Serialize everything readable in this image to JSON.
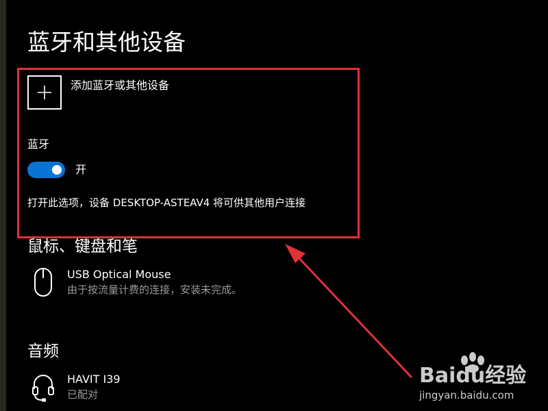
{
  "page": {
    "title": "蓝牙和其他设备"
  },
  "add_device": {
    "label": "添加蓝牙或其他设备",
    "icon": "plus-icon"
  },
  "bluetooth": {
    "label": "蓝牙",
    "toggle_on": true,
    "state_label": "开",
    "description": "打开此选项，设备 DESKTOP-ASTEAV4 将可供其他用户连接"
  },
  "sections": {
    "mouse_keyboard_pen": {
      "title": "鼠标、键盘和笔",
      "devices": [
        {
          "icon": "mouse-icon",
          "name": "USB Optical Mouse",
          "status": "由于按流量计费的连接，安装未完成。"
        }
      ]
    },
    "audio": {
      "title": "音频",
      "devices": [
        {
          "icon": "headset-icon",
          "name": "HAVIT I39",
          "status": "已配对"
        }
      ]
    }
  },
  "watermark": {
    "logo_text": "Baidu经验",
    "url": "jingyan.baidu.com"
  },
  "colors": {
    "background": "#000000",
    "accent": "#0a74d6",
    "highlight_border": "#e13238",
    "secondary_text": "#9a9a9a"
  }
}
